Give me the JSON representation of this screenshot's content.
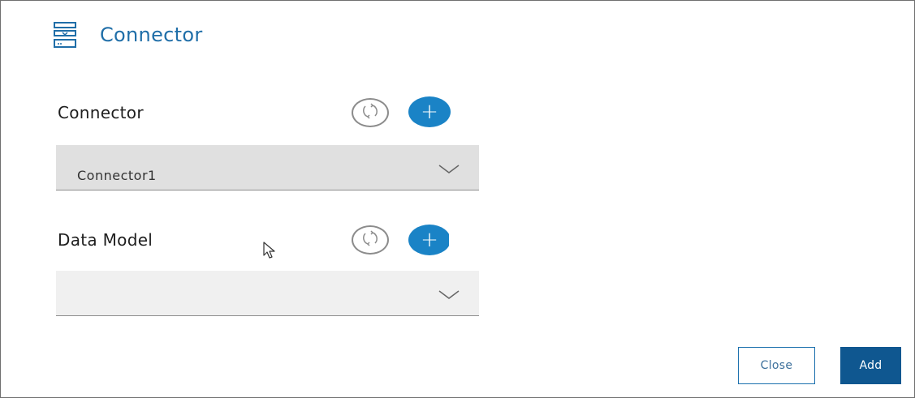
{
  "header": {
    "title": "Connector",
    "icon": "server-stack-icon"
  },
  "connector_section": {
    "label": "Connector",
    "refresh_icon": "refresh-icon",
    "add_icon": "plus-icon",
    "add_symbol": "+",
    "dropdown_value": "Connector1"
  },
  "data_model_section": {
    "label": "Data Model",
    "refresh_icon": "refresh-icon",
    "add_icon": "plus-icon",
    "add_symbol": "+",
    "dropdown_value": ""
  },
  "footer": {
    "close_label": "Close",
    "add_label": "Add"
  },
  "colors": {
    "accent": "#1a83c6",
    "title": "#1f6ea8",
    "primary_button": "#0f5790",
    "dropdown_selected_bg": "#e0e0e0",
    "dropdown_empty_bg": "#f0f0f0"
  }
}
